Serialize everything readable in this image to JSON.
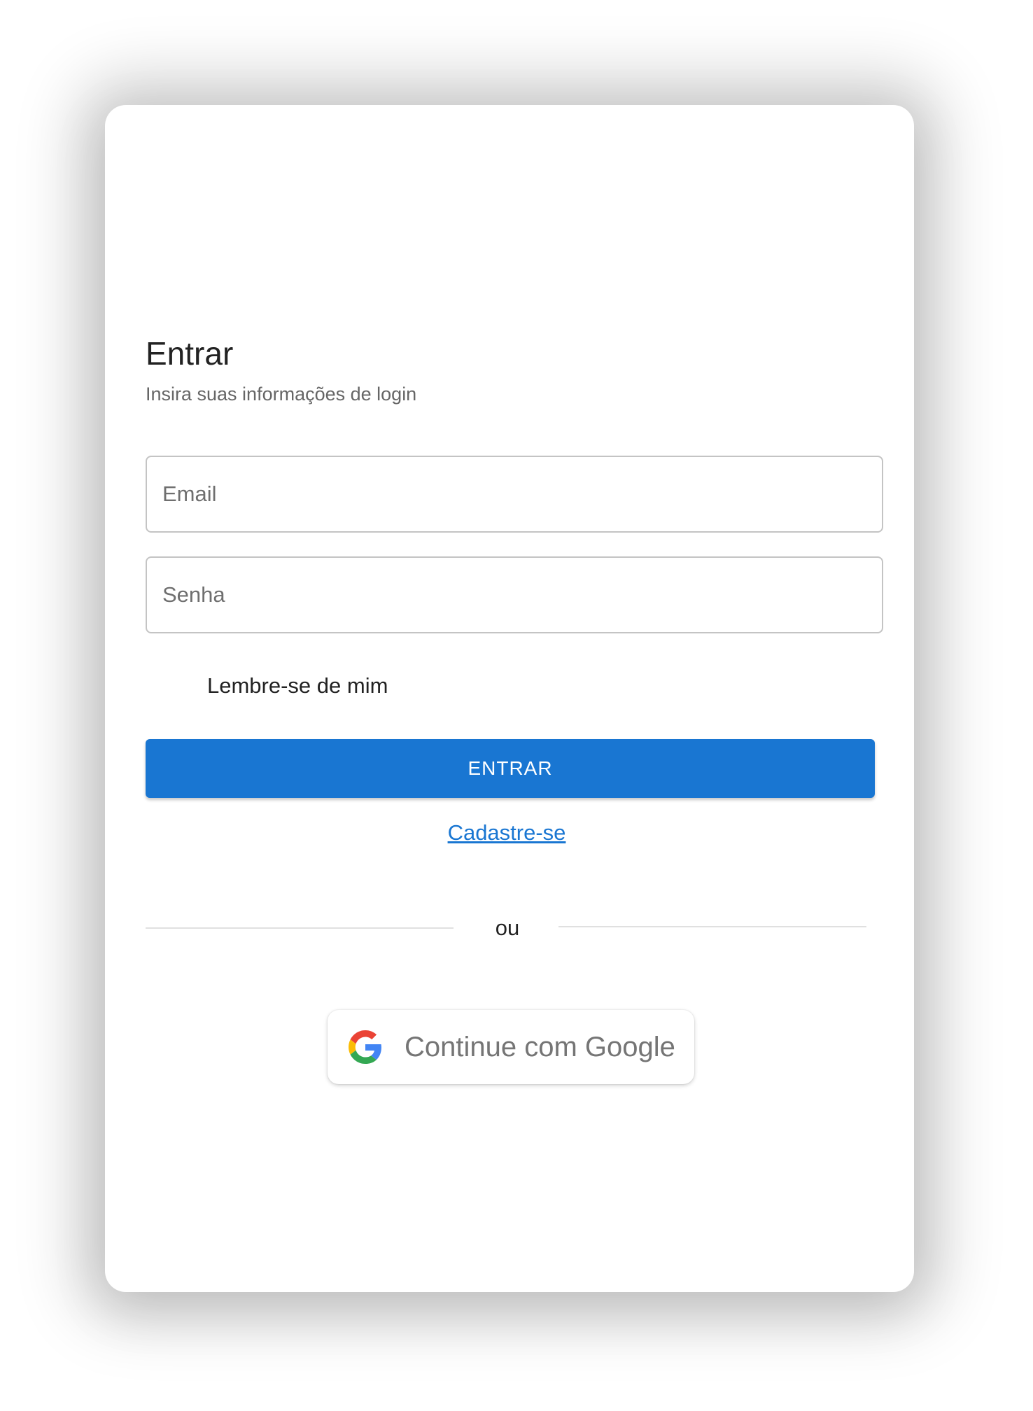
{
  "login": {
    "title": "Entrar",
    "subtitle": "Insira suas informações de login",
    "email_placeholder": "Email",
    "password_placeholder": "Senha",
    "remember_label": "Lembre-se de mim",
    "submit_label": "ENTRAR",
    "signup_link": "Cadastre-se",
    "divider_text": "ou",
    "google_label": "Continue com Google"
  },
  "colors": {
    "primary": "#1976d2",
    "link": "#1976d2",
    "google_blue": "#4285F4",
    "google_red": "#EA4335",
    "google_yellow": "#FBBC05",
    "google_green": "#34A853"
  },
  "icons": {
    "google": "google-g-logo"
  }
}
